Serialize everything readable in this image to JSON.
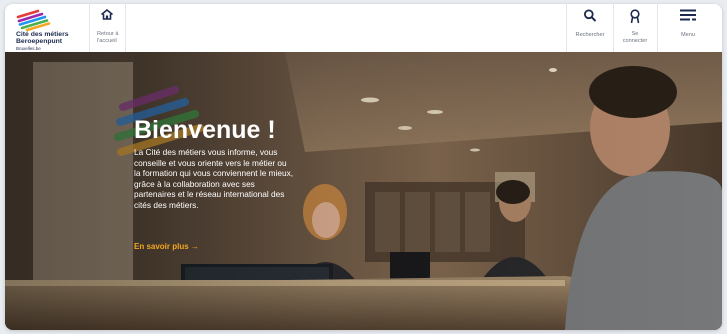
{
  "header": {
    "logo": {
      "line1": "Cité des métiers",
      "line2": "Beroepenpunt",
      "line3": "Bruxelles.be"
    },
    "home_label": "Retour à l'accueil",
    "search_label": "Rechercher",
    "login_label": "Se connecter",
    "menu_label": "Menu"
  },
  "hero": {
    "title": "Bienvenue !",
    "text": "La Cité des métiers vous informe, vous conseille et vous oriente vers le métier ou la formation qui vous conviennent le mieux, grâce à la collaboration avec ses partenaires et le réseau international des cités des métiers.",
    "link_label": "En savoir plus →"
  },
  "colors": {
    "brand_navy": "#1b2a4e",
    "accent_orange": "#f5a623",
    "logo_stripes": [
      "#e63b3b",
      "#f5a623",
      "#4caf50",
      "#2196f3",
      "#9c27b0"
    ]
  }
}
